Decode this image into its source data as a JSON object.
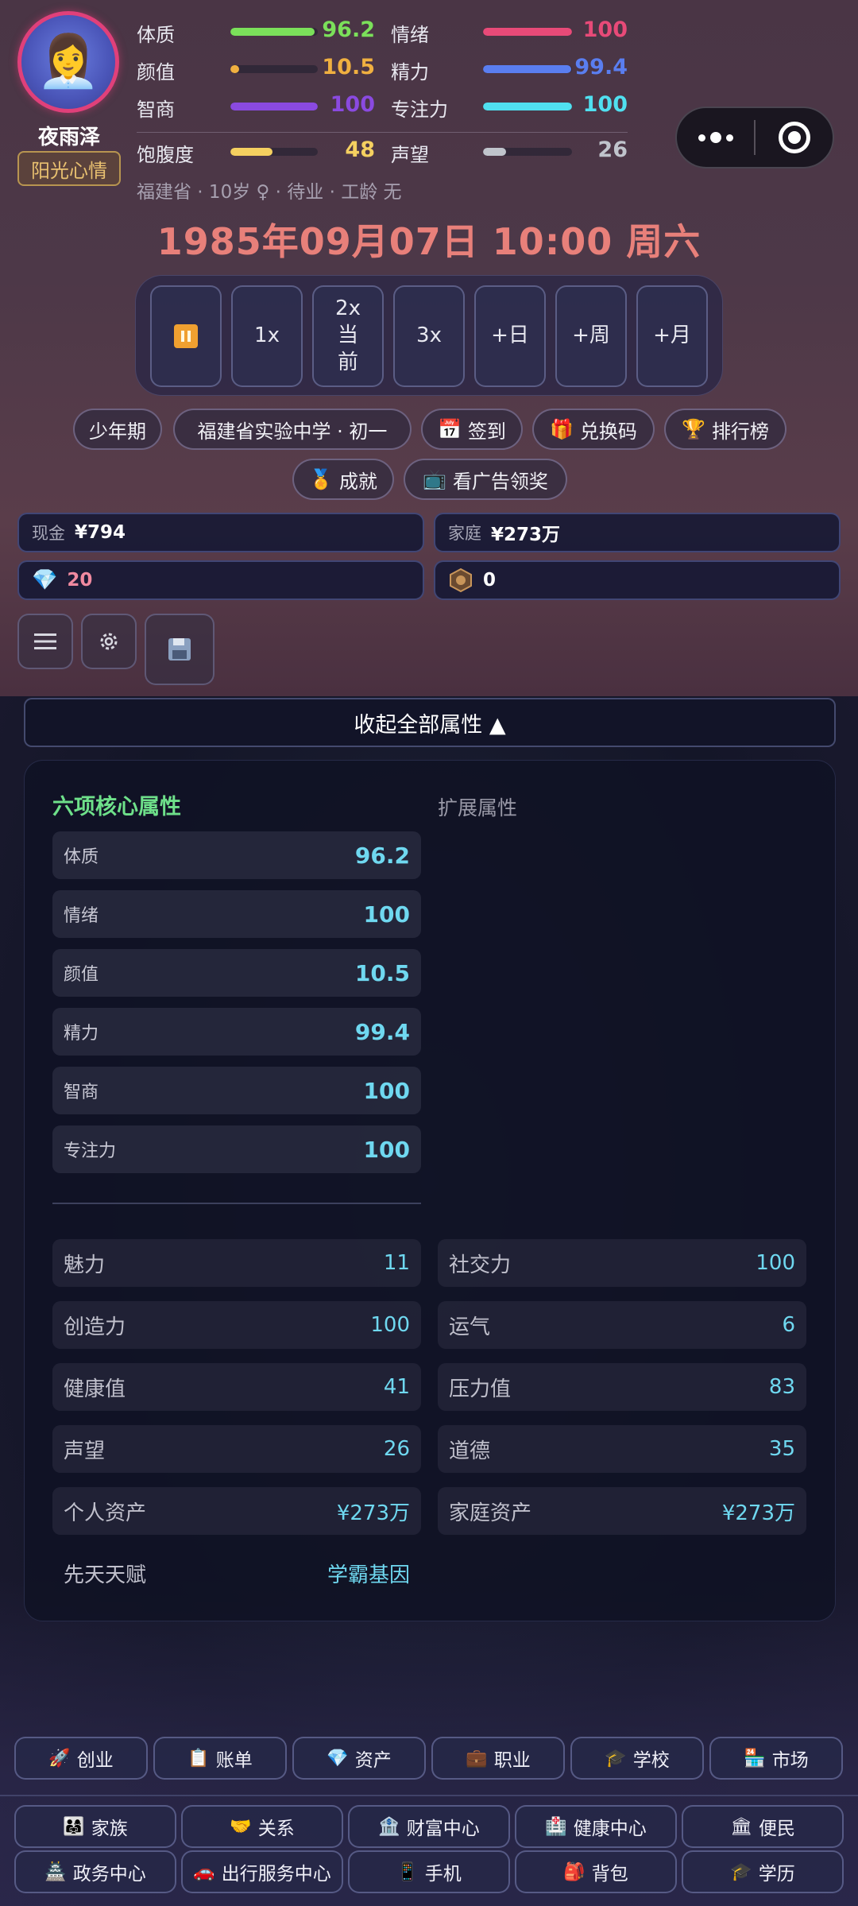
{
  "profile": {
    "name": "夜雨泽",
    "mood": "阳光心情",
    "avatar_icon": "👩‍💼",
    "sub_info": "福建省 · 10岁 ♀ · 待业 · 工龄 无"
  },
  "stats": [
    {
      "label": "体质",
      "value": "96.2",
      "fill": 0.96,
      "color": "#7be05a"
    },
    {
      "label": "情绪",
      "value": "100",
      "fill": 1.0,
      "color": "#e84a78"
    },
    {
      "label": "颜值",
      "value": "10.5",
      "fill": 0.1,
      "color": "#f0b040"
    },
    {
      "label": "精力",
      "value": "99.4",
      "fill": 0.99,
      "color": "#5a7ef0"
    },
    {
      "label": "智商",
      "value": "100",
      "fill": 1.0,
      "color": "#8a4ae0"
    },
    {
      "label": "专注力",
      "value": "100",
      "fill": 1.0,
      "color": "#50e0f0"
    },
    {
      "label": "饱腹度",
      "value": "48",
      "fill": 0.48,
      "color": "#f5d060"
    },
    {
      "label": "声望",
      "value": "26",
      "fill": 0.26,
      "color": "#c0c4cc"
    }
  ],
  "datetime": "1985年09月07日 10:00 周六",
  "speed_buttons": [
    "1x",
    "2x\n当\n前",
    "3x",
    "+日",
    "+周",
    "+月"
  ],
  "chips": [
    {
      "icon": "",
      "label": "少年期"
    },
    {
      "icon": "",
      "label": "福建省实验中学 · 初一"
    },
    {
      "icon": "📅",
      "label": "签到"
    },
    {
      "icon": "🎁",
      "label": "兑换码"
    },
    {
      "icon": "🏆",
      "label": "排行榜"
    },
    {
      "icon": "🏅",
      "label": "成就"
    },
    {
      "icon": "📺",
      "label": "看广告领奖"
    }
  ],
  "money": {
    "cash_label": "现金",
    "cash_value": "¥794",
    "family_label": "家庭",
    "family_value": "¥273万",
    "diamond_value": "20",
    "token_value": "0"
  },
  "collapse_label": "收起全部属性 ▲",
  "core_title": "六项核心属性",
  "ext_title": "扩展属性",
  "core_attrs": [
    {
      "label": "体质",
      "value": "96.2"
    },
    {
      "label": "情绪",
      "value": "100"
    },
    {
      "label": "颜值",
      "value": "10.5"
    },
    {
      "label": "精力",
      "value": "99.4"
    },
    {
      "label": "智商",
      "value": "100"
    },
    {
      "label": "专注力",
      "value": "100"
    }
  ],
  "ext_attrs": [
    {
      "label": "魅力",
      "value": "11"
    },
    {
      "label": "社交力",
      "value": "100"
    },
    {
      "label": "创造力",
      "value": "100"
    },
    {
      "label": "运气",
      "value": "6"
    },
    {
      "label": "健康值",
      "value": "41"
    },
    {
      "label": "压力值",
      "value": "83"
    },
    {
      "label": "声望",
      "value": "26"
    },
    {
      "label": "道德",
      "value": "35"
    },
    {
      "label": "个人资产",
      "value": "¥273万"
    },
    {
      "label": "家庭资产",
      "value": "¥273万"
    },
    {
      "label": "先天天赋",
      "value": "学霸基因"
    }
  ],
  "nav_row1": [
    {
      "icon": "🚀",
      "label": "创业"
    },
    {
      "icon": "📋",
      "label": "账单"
    },
    {
      "icon": "💎",
      "label": "资产"
    },
    {
      "icon": "💼",
      "label": "职业"
    },
    {
      "icon": "🎓",
      "label": "学校"
    },
    {
      "icon": "🏪",
      "label": "市场"
    }
  ],
  "nav_row2": [
    {
      "icon": "👨‍👩‍👧",
      "label": "家族"
    },
    {
      "icon": "🤝",
      "label": "关系"
    },
    {
      "icon": "🏦",
      "label": "财富中心"
    },
    {
      "icon": "🏥",
      "label": "健康中心"
    },
    {
      "icon": "🏛",
      "label": "便民"
    }
  ],
  "nav_row3": [
    {
      "icon": "🏯",
      "label": "政务中心"
    },
    {
      "icon": "🚗",
      "label": "出行服务中心"
    },
    {
      "icon": "📱",
      "label": "手机"
    },
    {
      "icon": "🎒",
      "label": "背包"
    },
    {
      "icon": "🎓",
      "label": "学历"
    }
  ]
}
